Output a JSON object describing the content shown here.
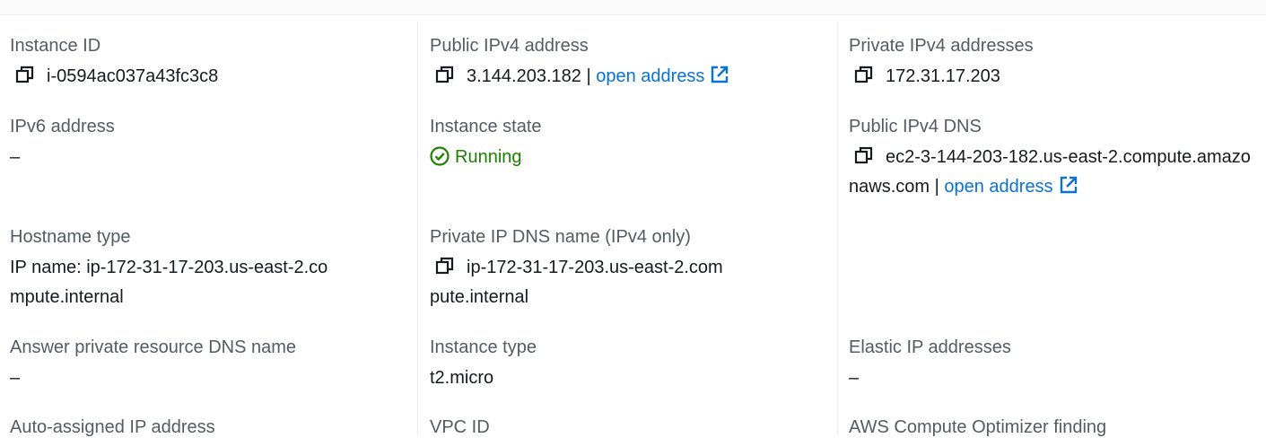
{
  "col1": {
    "instance_id": {
      "label": "Instance ID",
      "value": "i-0594ac037a43fc3c8"
    },
    "ipv6_address": {
      "label": "IPv6 address",
      "value": "–"
    },
    "hostname_type": {
      "label": "Hostname type",
      "value": "IP name: ip-172-31-17-203.us-east-2.compute.internal"
    },
    "answer_private_dns": {
      "label": "Answer private resource DNS name",
      "value": "–"
    },
    "auto_assigned_ip": {
      "label": "Auto-assigned IP address"
    }
  },
  "col2": {
    "public_ipv4": {
      "label": "Public IPv4 address",
      "value": "3.144.203.182",
      "separator": "|",
      "link": "open address"
    },
    "instance_state": {
      "label": "Instance state",
      "value": "Running"
    },
    "private_ip_dns": {
      "label": "Private IP DNS name (IPv4 only)",
      "value": "ip-172-31-17-203.us-east-2.compute.internal"
    },
    "instance_type": {
      "label": "Instance type",
      "value": "t2.micro"
    },
    "vpc_id": {
      "label": "VPC ID"
    }
  },
  "col3": {
    "private_ipv4": {
      "label": "Private IPv4 addresses",
      "value": "172.31.17.203"
    },
    "public_ipv4_dns": {
      "label": "Public IPv4 DNS",
      "value": "ec2-3-144-203-182.us-east-2.compute.amazonaws.com",
      "separator": "|",
      "link": "open address"
    },
    "elastic_ip": {
      "label": "Elastic IP addresses",
      "value": "–"
    },
    "compute_optimizer": {
      "label": "AWS Compute Optimizer finding"
    }
  },
  "colors": {
    "label": "#545b64",
    "text": "#16191f",
    "link": "#0972d3",
    "success": "#1d8102",
    "divider": "#eaeded"
  },
  "icons": {
    "copy": "copy-icon",
    "external": "external-link-icon",
    "status": "status-success-icon"
  }
}
